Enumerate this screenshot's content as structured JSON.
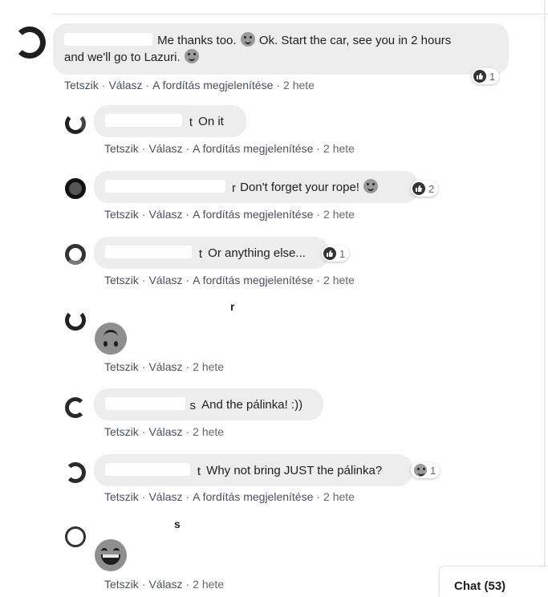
{
  "actions": {
    "like": "Tetszik",
    "reply": "Válasz",
    "translation": "A fordítás megjelenítése",
    "age": "2 hete",
    "separator": "·"
  },
  "comments": [
    {
      "text_line1": "Me thanks too.",
      "text_line1b": "Ok. Start the car, see you in 2 hours",
      "text_line2": "and we'll go to Lazuri.",
      "reaction_count": "1"
    },
    {
      "name_tail": "t",
      "text": "On it"
    },
    {
      "name_tail": "r",
      "text": "Don't forget your rope!",
      "reaction_count": "2"
    },
    {
      "name_tail": "t",
      "text": "Or anything else...",
      "reaction_count": "1"
    },
    {
      "name_tail": "r",
      "sticker": "upside-down-face-emoji"
    },
    {
      "name_tail": "s",
      "text": "And the pálinka! :))"
    },
    {
      "name_tail": "t",
      "text": "Why not bring JUST the pálinka?",
      "reaction_count": "1"
    },
    {
      "name_tail": "s",
      "sticker": "laughing-face-emoji"
    }
  ],
  "chat": {
    "label": "Chat (53)"
  },
  "colors": {
    "bubble": "#ededed",
    "meta_text": "#65676b"
  }
}
